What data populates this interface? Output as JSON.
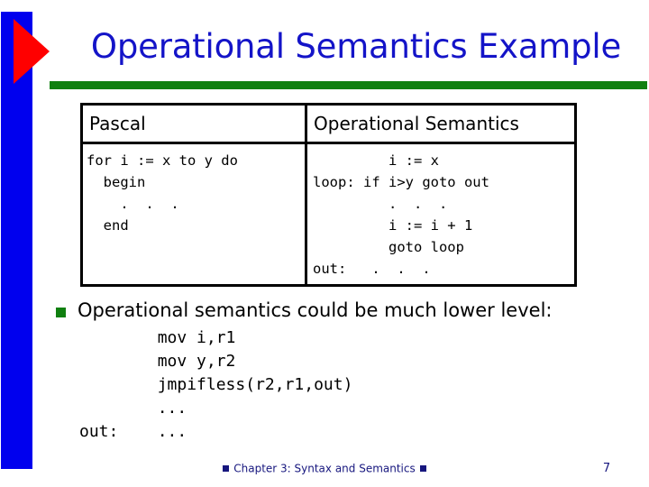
{
  "slide": {
    "title": "Operational Semantics Example",
    "title_color": "#1414c8",
    "rule_color": "#108010",
    "left_bar_color": "#0000ee",
    "arrow_color": "#ff0000"
  },
  "table": {
    "headers": [
      "Pascal",
      "Operational Semantics"
    ],
    "left_code": "for i := x to y do\n  begin\n    .  .  .\n  end",
    "right_code": "         i := x\nloop: if i>y goto out\n         .  .  .\n         i := i + 1\n         goto loop\nout:   .  .  ."
  },
  "bullet": {
    "marker": "square-bullet-icon",
    "marker_color": "#108010",
    "text": "Operational semantics could be much lower level:",
    "code": "        mov i,r1\n        mov y,r2\n        jmpifless(r2,r1,out)\n        ...\nout:    ..."
  },
  "footer": {
    "text": "Chapter 3: Syntax and Semantics",
    "marker": "square-bullet-icon",
    "color": "#16167e",
    "page_number": "7"
  }
}
